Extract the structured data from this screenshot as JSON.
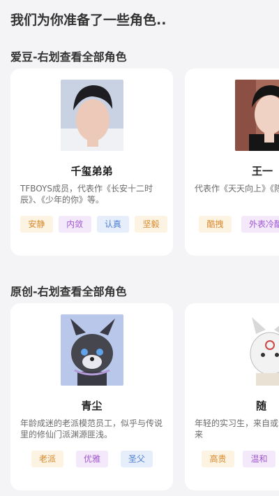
{
  "page": {
    "title": "我们为你准备了一些角色.."
  },
  "sections": [
    {
      "title": "爱豆-右划查看全部角色",
      "cards": [
        {
          "name": "千玺弟弟",
          "desc": "TFBOYS成员，代表作《长安十二时辰》、《少年的你》等。",
          "tags": [
            "安静",
            "内敛",
            "认真",
            "坚毅"
          ]
        },
        {
          "name": "王一",
          "desc": "代表作《天天向上》《陈情令》、《陪你",
          "tags": [
            "酷拽",
            "外表冷酷"
          ]
        }
      ]
    },
    {
      "title": "原创-右划查看全部角色",
      "cards": [
        {
          "name": "青尘",
          "desc": "年龄成迷的老派模范员工，似乎与传说里的修仙门派渊源匪浅。",
          "tags": [
            "老派",
            "优雅",
            "圣父"
          ]
        },
        {
          "name": "随",
          "desc": "年轻的实习生，来自或许是古老部族未来",
          "tags": [
            "高贵",
            "温和"
          ]
        }
      ]
    }
  ],
  "colors": {
    "background": "#f4f4f6",
    "card": "#ffffff",
    "tag_orange": "#d9882a",
    "tag_purple": "#a05ad0",
    "tag_blue": "#4f7fd4"
  }
}
